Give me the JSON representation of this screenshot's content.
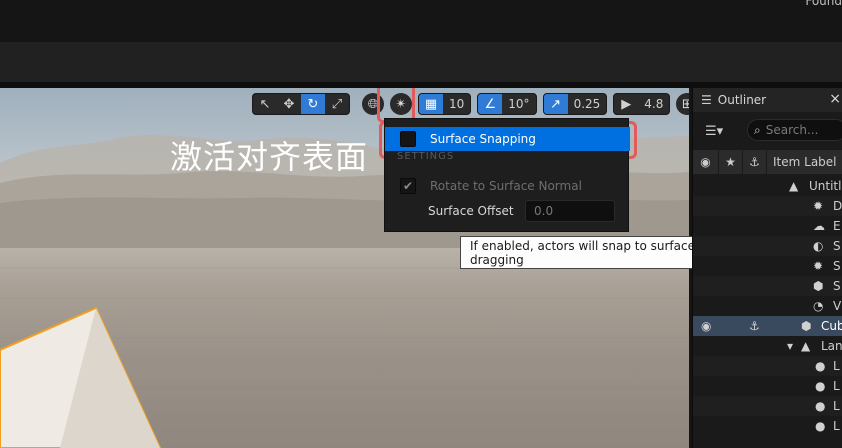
{
  "topbar": {
    "corner_text": "Found"
  },
  "viewport_toolbar": {
    "grid_snap_value": "10",
    "rotation_snap_value": "10°",
    "scale_snap_value": "0.25",
    "camera_speed_value": "4.8"
  },
  "caption": "激活对齐表面",
  "dropdown": {
    "surface_snapping_label": "Surface Snapping",
    "section_label": "SETTINGS",
    "rotate_label": "Rotate to Surface Normal",
    "offset_label": "Surface Offset",
    "offset_value": "0.0"
  },
  "tooltip": "If enabled, actors will snap to surfaces in the world when dragging",
  "outliner": {
    "title": "Outliner",
    "close": "×",
    "search_placeholder": "Search...",
    "col_item_label": "Item Label",
    "rows": [
      "Untitled",
      "D",
      "E",
      "S",
      "S",
      "S",
      "V",
      "Cube",
      "Lan",
      "L",
      "L",
      "L",
      "L"
    ]
  },
  "colors": {
    "accent": "#0070e0",
    "highlight_box": "#e05c5c",
    "selection_outline": "#f0a020"
  }
}
